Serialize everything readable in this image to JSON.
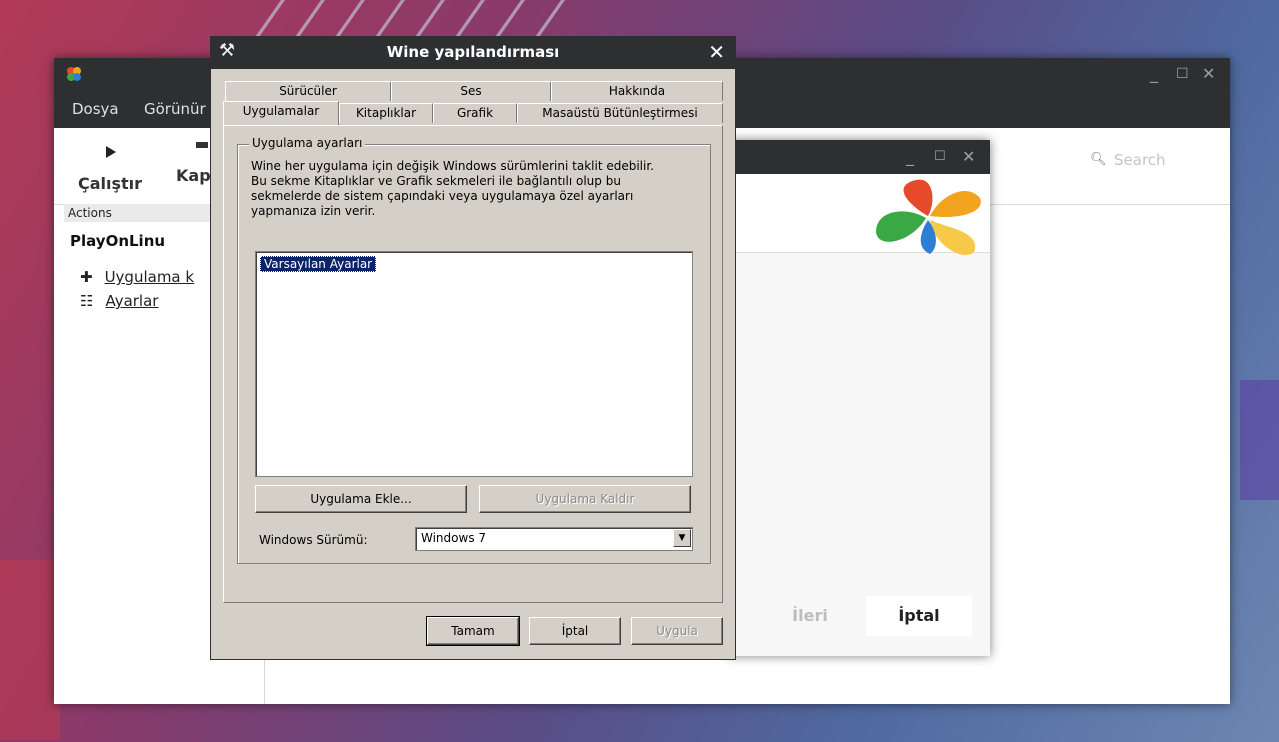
{
  "pol": {
    "menu": [
      "Dosya",
      "Görünür"
    ],
    "toolbar": {
      "run_label": "Çalıştır",
      "close_label": "Kap"
    },
    "search_placeholder": "Search",
    "sidebar": {
      "actions_header": "Actions",
      "title": "PlayOnLinu",
      "items": [
        "Uygulama k",
        "Ayarlar"
      ]
    }
  },
  "wizard": {
    "next_label": "İleri",
    "cancel_label": "İptal"
  },
  "wine": {
    "title": "Wine yapılandırması",
    "tabs_row1": [
      "Sürücüler",
      "Ses",
      "Hakkında"
    ],
    "tabs_row2": [
      "Uygulamalar",
      "Kitaplıklar",
      "Grafik",
      "Masaüstü Bütünleştirmesi"
    ],
    "active_tab": "Uygulamalar",
    "group_title": "Uygulama ayarları",
    "description": "Wine her uygulama için değişik Windows sürümlerini taklit edebilir. Bu sekme Kitaplıklar ve Grafik sekmeleri ile bağlantılı olup bu sekmelerde de sistem çapındaki veya uygulamaya özel ayarları yapmanıza izin verir.",
    "applist_items": [
      "Varsayılan Ayarlar"
    ],
    "add_app_label": "Uygulama Ekle...",
    "remove_app_label": "Uygulama Kaldır",
    "windows_version_label": "Windows Sürümü:",
    "windows_version_value": "Windows 7",
    "ok_label": "Tamam",
    "cancel_label": "İptal",
    "apply_label": "Uygula"
  }
}
